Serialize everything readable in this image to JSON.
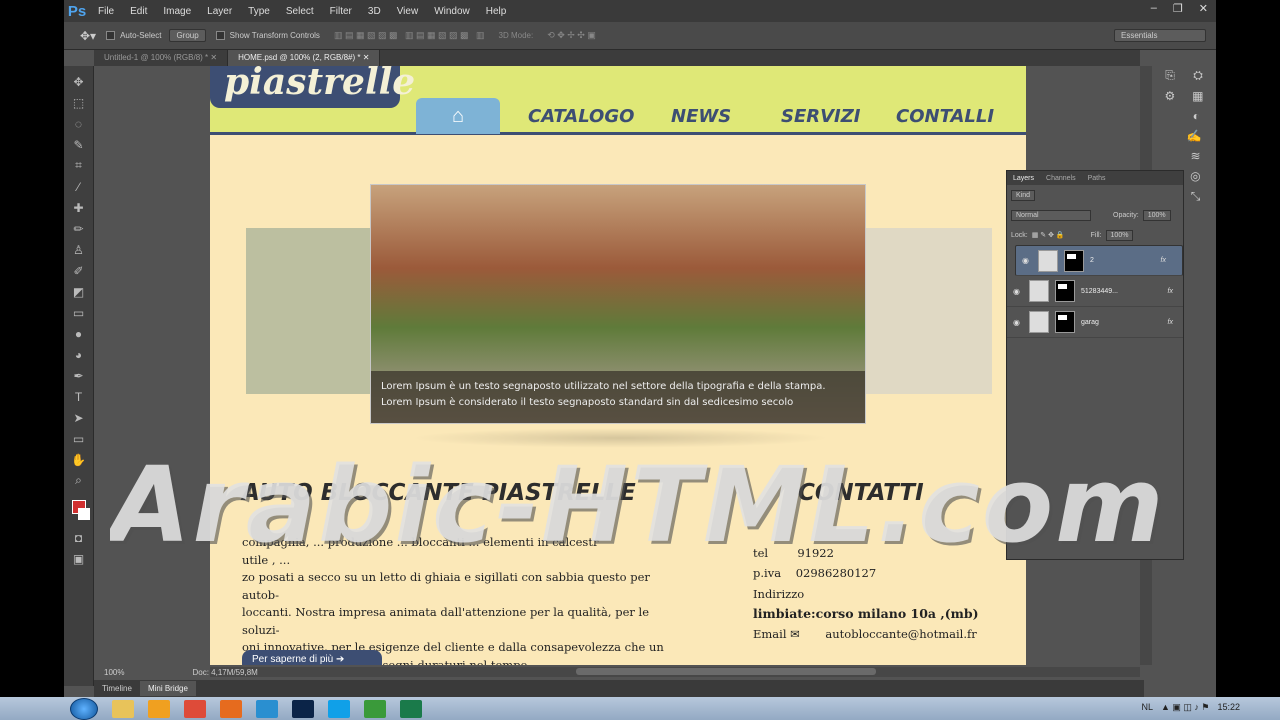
{
  "app": {
    "logo": "Ps",
    "menu": [
      "File",
      "Edit",
      "Image",
      "Layer",
      "Type",
      "Select",
      "Filter",
      "3D",
      "View",
      "Window",
      "Help"
    ]
  },
  "options": {
    "auto_select": "Auto-Select",
    "group": "Group",
    "show_transform": "Show Transform Controls",
    "mode_3d": "3D Mode:",
    "workspace": "Essentials"
  },
  "doc_tabs": [
    "Untitled-1 @ 100% (RGB/8) *",
    "HOME.psd @ 100% (2, RGB/8#) *"
  ],
  "status": {
    "zoom": "100%",
    "doc": "Doc: 4,17M/59,8M"
  },
  "bottom_tabs": [
    "Timeline",
    "Mini Bridge"
  ],
  "layers_panel": {
    "tabs": [
      "Layers",
      "Channels",
      "Paths"
    ],
    "kind": "Kind",
    "blend": "Normal",
    "opacity_label": "Opacity:",
    "opacity": "100%",
    "lock_label": "Lock:",
    "fill_label": "Fill:",
    "fill": "100%",
    "layers": [
      {
        "name": "2",
        "fx": "fx"
      },
      {
        "name": "51283449...",
        "fx": "fx"
      },
      {
        "name": "garag",
        "fx": "fx"
      }
    ]
  },
  "web": {
    "logo": "piastrelle",
    "nav": [
      "CATALOGO",
      "NEWS",
      "SERVIZI",
      "CONTALLI"
    ],
    "caption1": "Lorem Ipsum è un testo segnaposto utilizzato nel settore della tipografia e della stampa.",
    "caption2": "Lorem Ipsum è considerato il testo segnaposto standard sin dal sedicesimo secolo",
    "heading_left": "AUTO BLOCCANTE PIASTRELLE",
    "heading_right": "CONTATTI",
    "para": [
      "compagnia, ... produzione ... bloccanti ... elementi in calcestr",
      "utile , ... ",
      "zo posati a secco su un letto di ghiaia e sigillati con sabbia questo per autob-",
      "loccanti. Nostra impresa  animata dall'attenzione per la qualità, per le soluzi-",
      "oni innovative, per le esigenze del cliente e dalla consapevolezza che un",
      "lavoro ben svolto lascia segni duraturi nel tempo."
    ],
    "tel_label": "tel",
    "tel": "91922",
    "piva_label": "p.iva",
    "piva": "02986280127",
    "addr_label": "Indirizzo",
    "addr": "limbiate:corso milano 10a ,(mb)",
    "email_label": "Email",
    "email": "autobloccante@hotmail.fr",
    "button": "Per saperne di più"
  },
  "watermark": "Arabic-HTML.com",
  "tray": {
    "lang": "NL",
    "time": "15:22"
  }
}
